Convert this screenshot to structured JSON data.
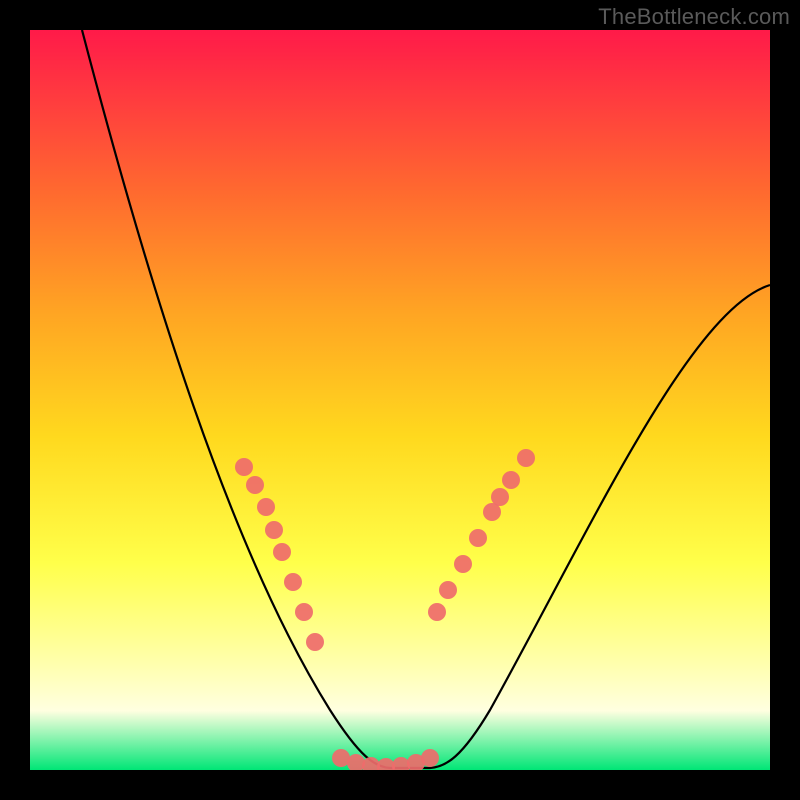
{
  "watermark": "TheBottleneck.com",
  "chart_data": {
    "type": "line",
    "title": "",
    "xlabel": "",
    "ylabel": "",
    "xlim": [
      0,
      100
    ],
    "ylim": [
      0,
      100
    ],
    "series": [
      {
        "name": "bottleneck-curve",
        "x": [
          7,
          12,
          17,
          22,
          26,
          30,
          33,
          36,
          38,
          40,
          42,
          44,
          46,
          48,
          50,
          52,
          54,
          56,
          58,
          60,
          63,
          67,
          72,
          78,
          85,
          93,
          100
        ],
        "y": [
          100,
          87,
          75,
          63,
          52,
          42,
          33,
          25,
          19,
          13,
          8,
          4,
          1,
          0,
          0,
          0,
          1,
          3,
          7,
          12,
          19,
          27,
          36,
          44,
          52,
          59,
          65
        ]
      }
    ],
    "markers": {
      "name": "highlight-points",
      "color": "#f06d6d",
      "x_left": [
        29,
        30.5,
        32,
        33,
        34,
        35.5,
        37,
        38.5
      ],
      "y_left": [
        41,
        38.5,
        35,
        32,
        29,
        25,
        21,
        17
      ],
      "x_right": [
        55,
        56.5,
        58.5,
        60.5,
        62.5,
        63.5,
        65,
        67
      ],
      "y_right": [
        21,
        24,
        27.5,
        31,
        34.5,
        36.5,
        39,
        42
      ],
      "x_bottom": [
        42,
        44,
        46,
        48,
        50,
        52,
        54
      ],
      "y_bottom": [
        1,
        0.5,
        0.3,
        0.2,
        0.3,
        0.5,
        1
      ]
    }
  }
}
